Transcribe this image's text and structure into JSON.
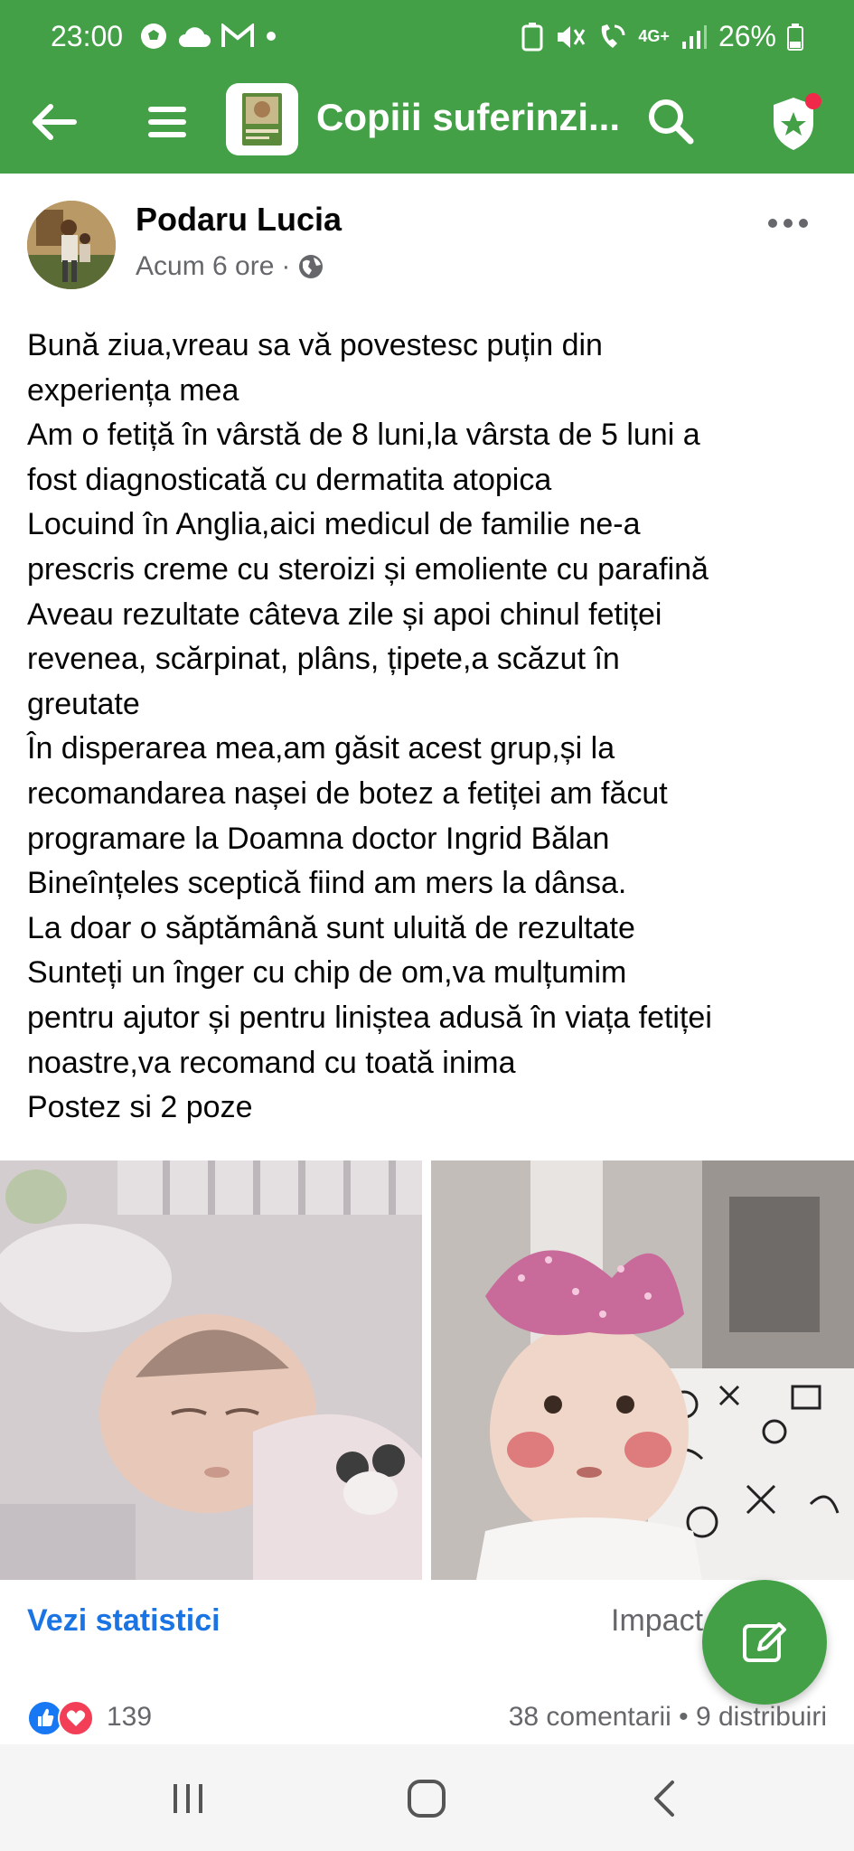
{
  "status_bar": {
    "time": "23:00",
    "battery": "26%",
    "network": "4G+"
  },
  "app_bar": {
    "title": "Copiii suferinzi...",
    "icons": [
      "back-arrow-icon",
      "menu-icon",
      "group-thumbnail",
      "search-icon",
      "admin-shield-icon"
    ],
    "accent_color": "#43a047",
    "badge_color": "#f02849"
  },
  "post": {
    "author": "Podaru Lucia",
    "timestamp": "Acum 6 ore",
    "separator": "·",
    "privacy_icon": "globe-icon",
    "text_lines": [
      "Bună ziua,vreau sa vă povestesc puțin din",
      "experiența mea",
      "Am o fetiță în vârstă de 8 luni,la vârsta de 5 luni a",
      "fost diagnosticată cu dermatita atopica",
      "Locuind în Anglia,aici medicul de familie ne-a",
      "prescris creme cu steroizi și emoliente cu parafină",
      "Aveau rezultate câteva zile și apoi chinul fetiței",
      "revenea, scărpinat, plâns, țipete,a scăzut în",
      "greutate",
      "În disperarea mea,am găsit acest grup,și la",
      "recomandarea nașei de botez a fetiței am făcut",
      "programare la Doamna doctor Ingrid Bălan",
      "Bineînțeles sceptică fiind am mers la dânsa.",
      "La doar o săptămână sunt uluită de rezultate",
      "Sunteți un înger cu chip de om,va mulțumim",
      "pentru ajutor și pentru liniștea adusă în viața fetiței",
      "noastre,va recomand cu toată inima",
      "Postez si 2 poze"
    ]
  },
  "stats": {
    "link_label": "Vezi statistici",
    "impact_label": "Impact"
  },
  "reactions": {
    "count": "139",
    "comments_shares": "38 comentarii • 9 distribuiri",
    "icons": [
      "like-icon",
      "love-icon"
    ]
  },
  "navigation": {
    "icons": [
      "recent-apps-icon",
      "home-icon",
      "back-icon"
    ]
  }
}
